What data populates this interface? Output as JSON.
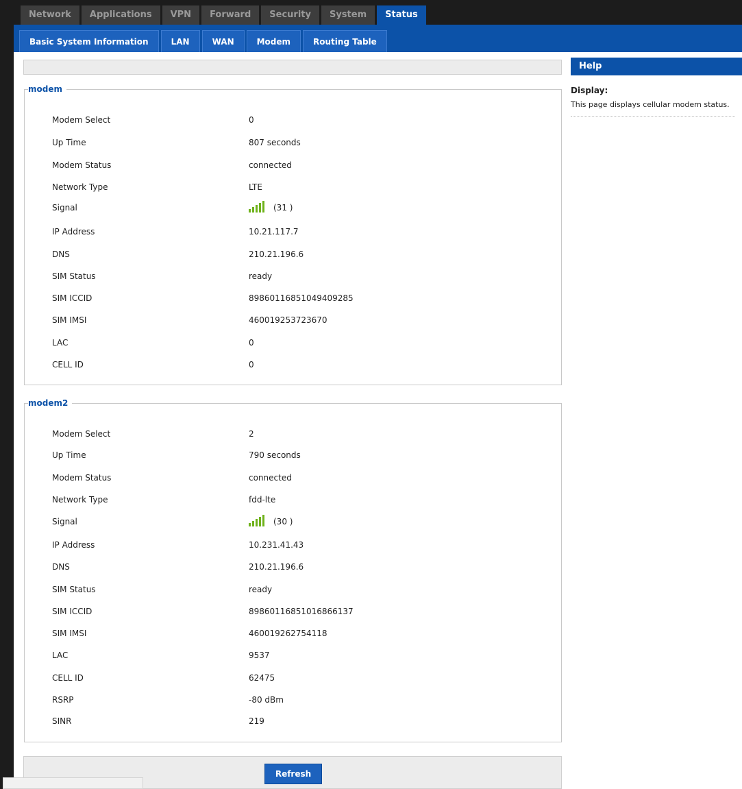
{
  "top_nav": {
    "tabs": [
      {
        "label": "Network",
        "active": false
      },
      {
        "label": "Applications",
        "active": false
      },
      {
        "label": "VPN",
        "active": false
      },
      {
        "label": "Forward",
        "active": false
      },
      {
        "label": "Security",
        "active": false
      },
      {
        "label": "System",
        "active": false
      },
      {
        "label": "Status",
        "active": true
      }
    ]
  },
  "sub_nav": {
    "tabs": [
      {
        "label": "Basic System Information"
      },
      {
        "label": "LAN"
      },
      {
        "label": "WAN"
      },
      {
        "label": "Modem"
      },
      {
        "label": "Routing Table"
      }
    ]
  },
  "modem": {
    "legend": "modem",
    "rows": [
      {
        "label": "Modem Select",
        "value": "0"
      },
      {
        "label": "Up Time",
        "value": "807 seconds"
      },
      {
        "label": "Modem Status",
        "value": "connected"
      },
      {
        "label": "Network Type",
        "value": "LTE"
      },
      {
        "label": "Signal",
        "value": "(31 )"
      },
      {
        "label": "IP Address",
        "value": "10.21.117.7"
      },
      {
        "label": "DNS",
        "value": "210.21.196.6"
      },
      {
        "label": "SIM Status",
        "value": "ready"
      },
      {
        "label": "SIM ICCID",
        "value": "89860116851049409285"
      },
      {
        "label": "SIM IMSI",
        "value": "460019253723670"
      },
      {
        "label": "LAC",
        "value": "0"
      },
      {
        "label": "CELL ID",
        "value": "0"
      }
    ]
  },
  "modem2": {
    "legend": "modem2",
    "rows": [
      {
        "label": "Modem Select",
        "value": "2"
      },
      {
        "label": "Up Time",
        "value": "790 seconds"
      },
      {
        "label": "Modem Status",
        "value": "connected"
      },
      {
        "label": "Network Type",
        "value": "fdd-lte"
      },
      {
        "label": "Signal",
        "value": "(30 )"
      },
      {
        "label": "IP Address",
        "value": "10.231.41.43"
      },
      {
        "label": "DNS",
        "value": "210.21.196.6"
      },
      {
        "label": "SIM Status",
        "value": "ready"
      },
      {
        "label": "SIM ICCID",
        "value": "89860116851016866137"
      },
      {
        "label": "SIM IMSI",
        "value": "460019262754118"
      },
      {
        "label": "LAC",
        "value": "9537"
      },
      {
        "label": "CELL ID",
        "value": "62475"
      },
      {
        "label": "RSRP",
        "value": "-80 dBm"
      },
      {
        "label": "SINR",
        "value": "219"
      }
    ]
  },
  "actions": {
    "refresh_label": "Refresh"
  },
  "help": {
    "header": "Help",
    "title": "Display:",
    "text": "This page displays cellular modem status."
  },
  "signal_icon": {
    "name": "signal-bars-icon",
    "color": "#6fb21b"
  },
  "colors": {
    "nav_dark": "#1c1c1c",
    "accent_blue": "#0c52a8",
    "tab_blue": "#1d62bd"
  }
}
